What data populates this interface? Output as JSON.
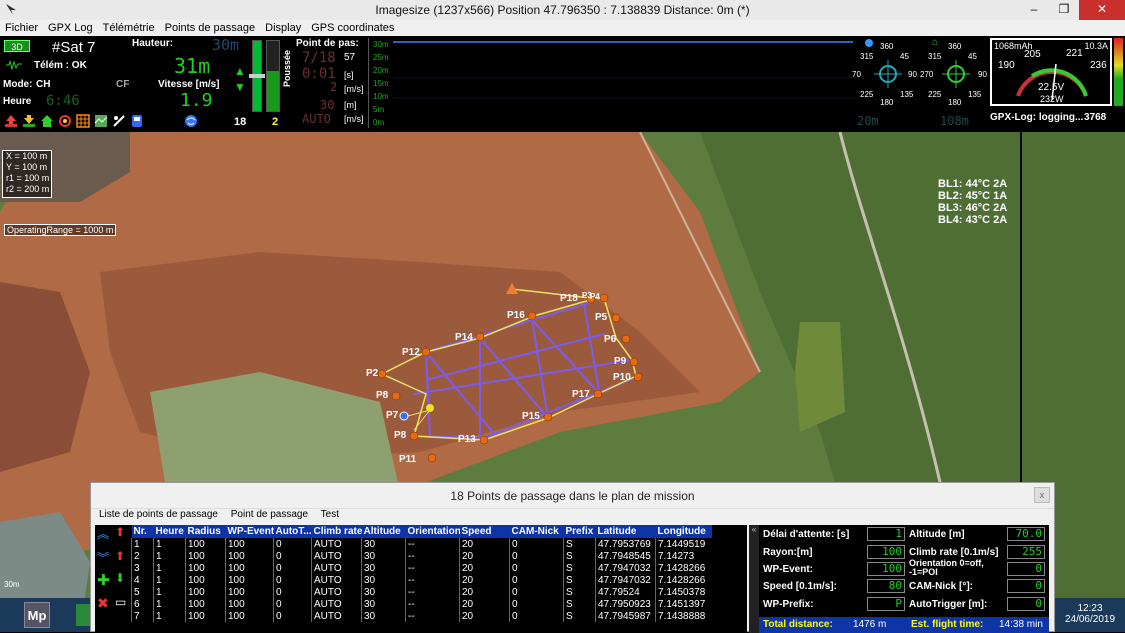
{
  "window": {
    "title": "Imagesize (1237x566) Position 47.796350 : 7.138839  Distance: 0m (*)",
    "minimize": "–",
    "restore": "❐",
    "close": "✕"
  },
  "menu": [
    "Fichier",
    "GPX Log",
    "Télémétrie",
    "Points de passage",
    "Display",
    "GPS coordinates"
  ],
  "osd": {
    "mode_3d": "3D",
    "sat": "#Sat 7",
    "telem": "Télém : OK",
    "mode_label": "Mode:",
    "mode_value": "CH",
    "cf": "CF",
    "heure_label": "Heure",
    "heure_value": "6:46",
    "hauteur_label": "Hauteur:",
    "hauteur_bg": "30m",
    "hauteur_value": "31m",
    "vitesse_label": "Vitesse [m/s]",
    "vitesse_value": "1.9",
    "poussee_label": "Poussée",
    "count_18": "18",
    "count_2": "2",
    "point_de_pas_label": "Point de pas:",
    "wp_index": "7/18",
    "wp_57": "57",
    "wp_time": "0:01",
    "wp_time_unit": "[s]",
    "wp_speed": "2",
    "wp_speed_unit": "[m/s]",
    "wp_dist": "30",
    "wp_dist_unit": "[m]",
    "wp_alt": "AUTO",
    "wp_alt_unit": "[m/s]",
    "alt_ticks": [
      "30m",
      "25m",
      "20m",
      "15m",
      "10m",
      "5m",
      "0m"
    ],
    "range_a": "20m",
    "range_b": "108m",
    "compass1": {
      "n": "360",
      "ne": "45",
      "nw": "315",
      "e": "90",
      "w": "70",
      "se": "135",
      "sw": "225",
      "s": "180"
    },
    "compass2": {
      "n": "360",
      "ne": "45",
      "nw": "315",
      "e": "90",
      "w": "270",
      "se": "135",
      "sw": "225",
      "s": "180"
    },
    "battery": {
      "mah": "1068mAh",
      "current": "10.3A",
      "v205": "205",
      "v221": "221",
      "v190": "190",
      "v236": "236",
      "voltage": "22.5V",
      "watts": "232W"
    },
    "gpx_log": "GPX-Log: logging...",
    "gpx_count": "3768"
  },
  "map": {
    "info_box": [
      "X = 100 m",
      "Y = 100 m",
      "r1 = 100 m",
      "r2 = 200 m"
    ],
    "operating_range": "OperatingRange = 1000 m",
    "bl": [
      "BL1: 44°C  2A",
      "BL2: 45°C  1A",
      "BL3: 46°C  2A",
      "BL4: 43°C  2A"
    ],
    "scale": "30m",
    "waypoints": [
      "P18",
      "P3",
      "P4",
      "P16",
      "P5",
      "P14",
      "P6",
      "P12",
      "P9",
      "P2",
      "P10",
      "P17",
      "P8",
      "P15",
      "P7",
      "P13",
      "P8",
      "P11"
    ]
  },
  "panel": {
    "title": "18 Points de passage dans le plan de mission",
    "close": "x",
    "menu": [
      "Liste de points de passage",
      "Point de passage",
      "Test"
    ],
    "columns": [
      "Nr.",
      "Heure",
      "Radius",
      "WP-Event",
      "AutoT...",
      "Climb rate",
      "Altitude",
      "Orientation",
      "Speed",
      "CAM-Nick",
      "Prefix",
      "Latitude",
      "Longitude"
    ],
    "rows": [
      [
        "1",
        "1",
        "100",
        "100",
        "0",
        "AUTO",
        "30",
        "--",
        "20",
        "0",
        "S",
        "47.7953769",
        "7.1449519"
      ],
      [
        "2",
        "1",
        "100",
        "100",
        "0",
        "AUTO",
        "30",
        "--",
        "20",
        "0",
        "S",
        "47.7948545",
        "7.14273"
      ],
      [
        "3",
        "1",
        "100",
        "100",
        "0",
        "AUTO",
        "30",
        "--",
        "20",
        "0",
        "S",
        "47.7947032",
        "7.1428266"
      ],
      [
        "4",
        "1",
        "100",
        "100",
        "0",
        "AUTO",
        "30",
        "--",
        "20",
        "0",
        "S",
        "47.7947032",
        "7.1428266"
      ],
      [
        "5",
        "1",
        "100",
        "100",
        "0",
        "AUTO",
        "30",
        "--",
        "20",
        "0",
        "S",
        "47.79524",
        "7.1450378"
      ],
      [
        "6",
        "1",
        "100",
        "100",
        "0",
        "AUTO",
        "30",
        "--",
        "20",
        "0",
        "S",
        "47.7950923",
        "7.1451397"
      ],
      [
        "7",
        "1",
        "100",
        "100",
        "0",
        "AUTO",
        "30",
        "--",
        "20",
        "0",
        "S",
        "47.7945987",
        "7.1438888"
      ]
    ],
    "props": {
      "delai_label": "Délai d'attente: [s]",
      "delai_value": "1",
      "rayon_label": "Rayon:[m]",
      "rayon_value": "100",
      "wpevent_label": "WP-Event:",
      "wpevent_value": "100",
      "speed_label": "Speed [0.1m/s]:",
      "speed_value": "80",
      "prefix_label": "WP-Prefix:",
      "prefix_value": "P",
      "altitude_label": "Altitude [m]",
      "altitude_value": "70.0",
      "climb_label": "Climb rate [0.1m/s]",
      "climb_value": "255",
      "orient_label": "Orientation 0=off, -1=POI",
      "orient_value": "0",
      "camnick_label": "CAM-Nick [°]:",
      "camnick_value": "0",
      "autotrig_label": "AutoTrigger [m]:",
      "autotrig_value": "0",
      "total_label": "Total distance:",
      "total_value": "1476 m",
      "flight_label": "Est. flight time:",
      "flight_value": "14:38 min"
    }
  },
  "taskbar": {
    "app": "Mp",
    "time": "12:23",
    "date": "24/06/2019"
  }
}
